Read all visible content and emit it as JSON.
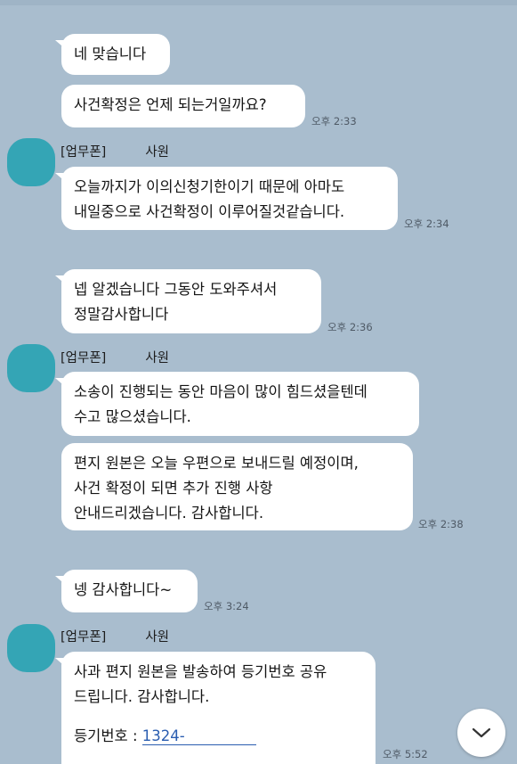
{
  "messages": {
    "m1": {
      "text": "네 맞습니다"
    },
    "m2": {
      "text": "사건확정은 언제 되는거일까요?",
      "time": "오후 2:33"
    },
    "g1": {
      "sender": "[업무폰]",
      "role": "사원",
      "line1": "오늘까지가 이의신청기한이기 때문에 아마도",
      "line2": "내일중으로 사건확정이 이루어질것같습니다.",
      "time": "오후 2:34"
    },
    "m3": {
      "line1": "넵 알겠습니다 그동안 도와주셔서",
      "line2": "정말감사합니다",
      "time": "오후 2:36"
    },
    "g2": {
      "sender": "[업무폰]",
      "role": "사원",
      "b1_line1": "소송이 진행되는 동안 마음이 많이 힘드셨을텐데",
      "b1_line2": "수고 많으셨습니다.",
      "b2_line1": "편지 원본은 오늘 우편으로 보내드릴 예정이며,",
      "b2_line2": "사건 확정이 되면 추가 진행 사항",
      "b2_line3": "안내드리겠습니다. 감사합니다.",
      "time": "오후 2:38"
    },
    "m4": {
      "text": "넹 감사합니다~",
      "time": "오후 3:24"
    },
    "g3": {
      "sender": "[업무폰]",
      "role": "사원",
      "line1": "사과 편지 원본을 발송하여 등기번호 공유",
      "line2": "드립니다. 감사합니다.",
      "reg_label": "등기번호 : ",
      "reg_number": "1324-",
      "time": "오후 5:52"
    }
  },
  "colors": {
    "background": "#a9bdce",
    "bubble": "#ffffff",
    "avatar": "#34a5b5",
    "link": "#2a5db0"
  },
  "icons": {
    "scroll_down": "chevron-down-icon"
  }
}
